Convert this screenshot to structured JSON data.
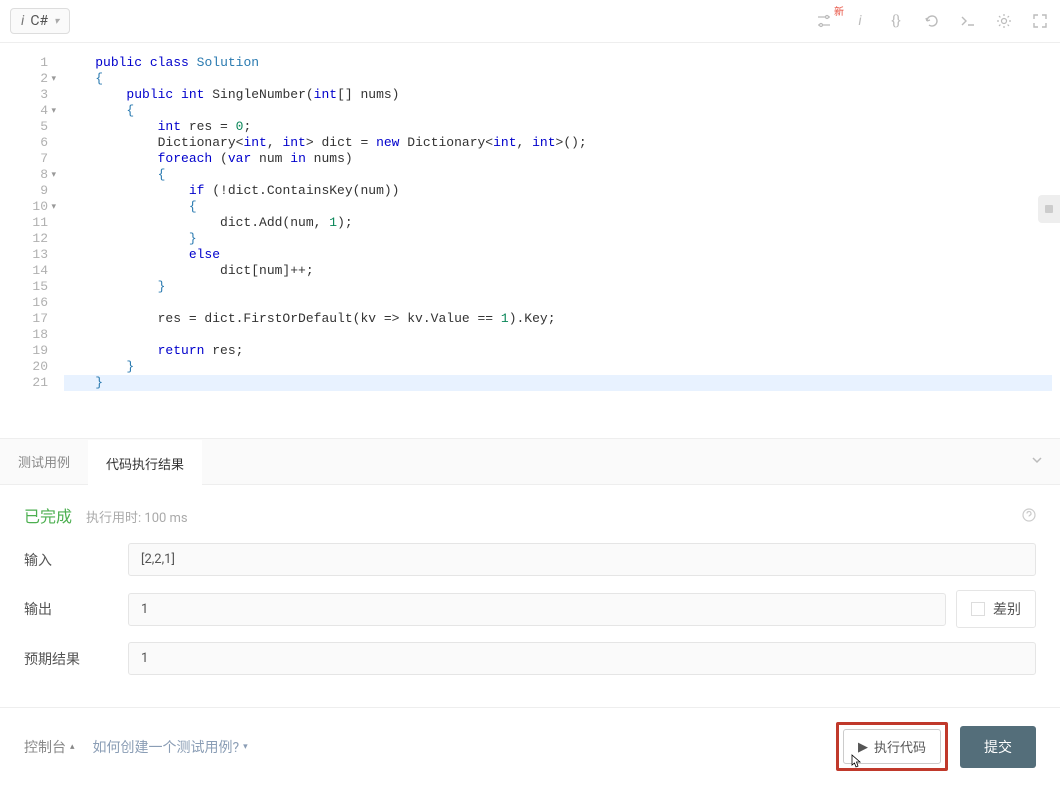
{
  "toolbar": {
    "language_prefix": "i",
    "language": "C#",
    "new_badge": "新"
  },
  "code": {
    "line_numbers": [
      "1",
      "2",
      "3",
      "4",
      "5",
      "6",
      "7",
      "8",
      "9",
      "10",
      "11",
      "12",
      "13",
      "14",
      "15",
      "16",
      "17",
      "18",
      "19",
      "20",
      "21"
    ],
    "fold_lines": [
      2,
      4,
      8,
      10
    ],
    "highlighted_line": 21,
    "tokens": [
      [
        {
          "t": "    ",
          "c": ""
        },
        {
          "t": "public",
          "c": "tok-kw"
        },
        {
          "t": " ",
          "c": ""
        },
        {
          "t": "class",
          "c": "tok-kw"
        },
        {
          "t": " ",
          "c": ""
        },
        {
          "t": "Solution",
          "c": "tok-name"
        }
      ],
      [
        {
          "t": "    ",
          "c": ""
        },
        {
          "t": "{",
          "c": "tok-brace"
        }
      ],
      [
        {
          "t": "        ",
          "c": ""
        },
        {
          "t": "public",
          "c": "tok-kw"
        },
        {
          "t": " ",
          "c": ""
        },
        {
          "t": "int",
          "c": "tok-kw"
        },
        {
          "t": " SingleNumber(",
          "c": ""
        },
        {
          "t": "int",
          "c": "tok-kw"
        },
        {
          "t": "[] nums)",
          "c": ""
        }
      ],
      [
        {
          "t": "        ",
          "c": ""
        },
        {
          "t": "{",
          "c": "tok-brace"
        }
      ],
      [
        {
          "t": "            ",
          "c": ""
        },
        {
          "t": "int",
          "c": "tok-kw"
        },
        {
          "t": " res = ",
          "c": ""
        },
        {
          "t": "0",
          "c": "tok-num"
        },
        {
          "t": ";",
          "c": ""
        }
      ],
      [
        {
          "t": "            Dictionary<",
          "c": ""
        },
        {
          "t": "int",
          "c": "tok-kw"
        },
        {
          "t": ", ",
          "c": ""
        },
        {
          "t": "int",
          "c": "tok-kw"
        },
        {
          "t": "> dict = ",
          "c": ""
        },
        {
          "t": "new",
          "c": "tok-kw"
        },
        {
          "t": " Dictionary<",
          "c": ""
        },
        {
          "t": "int",
          "c": "tok-kw"
        },
        {
          "t": ", ",
          "c": ""
        },
        {
          "t": "int",
          "c": "tok-kw"
        },
        {
          "t": ">();",
          "c": ""
        }
      ],
      [
        {
          "t": "            ",
          "c": ""
        },
        {
          "t": "foreach",
          "c": "tok-kw"
        },
        {
          "t": " (",
          "c": ""
        },
        {
          "t": "var",
          "c": "tok-kw"
        },
        {
          "t": " num ",
          "c": ""
        },
        {
          "t": "in",
          "c": "tok-kw"
        },
        {
          "t": " nums)",
          "c": ""
        }
      ],
      [
        {
          "t": "            ",
          "c": ""
        },
        {
          "t": "{",
          "c": "tok-brace"
        }
      ],
      [
        {
          "t": "                ",
          "c": ""
        },
        {
          "t": "if",
          "c": "tok-kw"
        },
        {
          "t": " (!dict.ContainsKey(num))",
          "c": ""
        }
      ],
      [
        {
          "t": "                ",
          "c": ""
        },
        {
          "t": "{",
          "c": "tok-brace"
        }
      ],
      [
        {
          "t": "                    dict.Add(num, ",
          "c": ""
        },
        {
          "t": "1",
          "c": "tok-num"
        },
        {
          "t": ");",
          "c": ""
        }
      ],
      [
        {
          "t": "                ",
          "c": ""
        },
        {
          "t": "}",
          "c": "tok-brace"
        }
      ],
      [
        {
          "t": "                ",
          "c": ""
        },
        {
          "t": "else",
          "c": "tok-kw"
        }
      ],
      [
        {
          "t": "                    dict[num]++;",
          "c": ""
        }
      ],
      [
        {
          "t": "            ",
          "c": ""
        },
        {
          "t": "}",
          "c": "tok-brace"
        }
      ],
      [
        {
          "t": "",
          "c": ""
        }
      ],
      [
        {
          "t": "            res = dict.FirstOrDefault(kv => kv.Value == ",
          "c": ""
        },
        {
          "t": "1",
          "c": "tok-num"
        },
        {
          "t": ").Key;",
          "c": ""
        }
      ],
      [
        {
          "t": "",
          "c": ""
        }
      ],
      [
        {
          "t": "            ",
          "c": ""
        },
        {
          "t": "return",
          "c": "tok-kw"
        },
        {
          "t": " res;",
          "c": ""
        }
      ],
      [
        {
          "t": "        ",
          "c": ""
        },
        {
          "t": "}",
          "c": "tok-brace"
        }
      ],
      [
        {
          "t": "    ",
          "c": ""
        },
        {
          "t": "}",
          "c": "tok-brace"
        }
      ]
    ]
  },
  "tabs": {
    "testcase": "测试用例",
    "result": "代码执行结果"
  },
  "result": {
    "status": "已完成",
    "runtime": "执行用时: 100 ms",
    "input_label": "输入",
    "input_value": "[2,2,1]",
    "output_label": "输出",
    "output_value": "1",
    "expected_label": "预期结果",
    "expected_value": "1",
    "diff_label": "差别"
  },
  "bottom": {
    "console": "控制台",
    "how_create": "如何创建一个测试用例?",
    "run": "执行代码",
    "submit": "提交"
  }
}
